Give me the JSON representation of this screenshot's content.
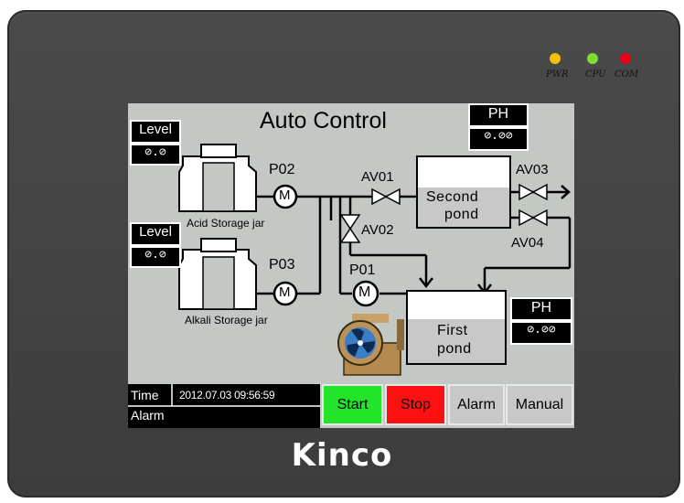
{
  "panel": {
    "brand": "Kinco",
    "leds": [
      {
        "label": "PWR",
        "color": "#f2c200"
      },
      {
        "label": "CPU",
        "color": "#7ce02a"
      },
      {
        "label": "COM",
        "color": "#e8001a"
      }
    ]
  },
  "screen": {
    "title": "Auto Control",
    "acid_level": {
      "label": "Level",
      "value": "⊘.⊘"
    },
    "alkali_level": {
      "label": "Level",
      "value": "⊘.⊘"
    },
    "ph_top": {
      "label": "PH",
      "value": "⊘.⊘⊘"
    },
    "ph_bottom": {
      "label": "PH",
      "value": "⊘.⊘⊘"
    },
    "acid_jar": "Acid Storage jar",
    "alkali_jar": "Alkali Storage jar",
    "pumps": {
      "p02": "P02",
      "p03": "P03",
      "p01": "P01",
      "symbol": "M"
    },
    "valves": {
      "av01": "AV01",
      "av02": "AV02",
      "av03": "AV03",
      "av04": "AV04"
    },
    "second_pond": [
      "Second",
      "pond"
    ],
    "first_pond": [
      "First",
      "pond"
    ],
    "time_label": "Time",
    "time_value": "2012.07.03 09:56:59",
    "alarm_label": "Alarm",
    "alarm_value": "",
    "buttons": {
      "start": {
        "label": "Start",
        "color": "#22e52a"
      },
      "stop": {
        "label": "Stop",
        "color": "#ff1010"
      },
      "alarm": {
        "label": "Alarm",
        "color": "#c8c8c8"
      },
      "manual": {
        "label": "Manual",
        "color": "#c8c8c8"
      }
    }
  }
}
